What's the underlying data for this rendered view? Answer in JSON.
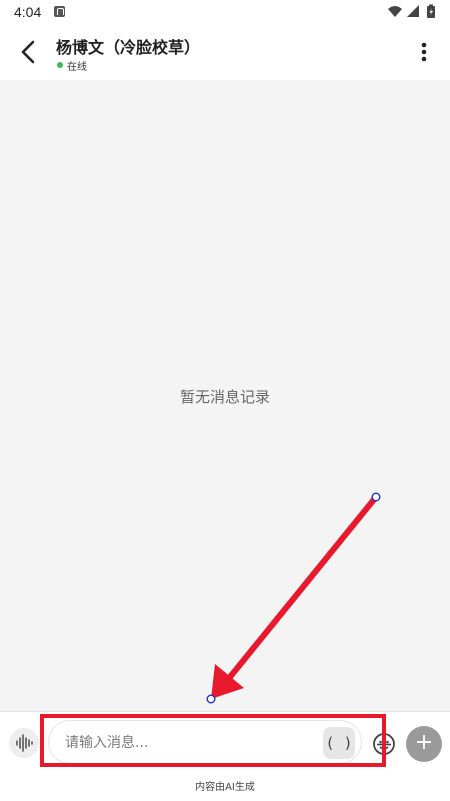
{
  "status_bar": {
    "time": "4:04"
  },
  "header": {
    "contact_name": "杨博文（冷脸校草）",
    "online_status": "在线"
  },
  "chat": {
    "empty_text": "暂无消息记录"
  },
  "composer": {
    "placeholder": "请输入消息...",
    "paren_label": "( )",
    "add_label": "+"
  },
  "footer": {
    "notice": "内容由AI生成"
  },
  "colors": {
    "online_dot": "#3cba54",
    "annotation_red": "#e8192c",
    "chat_background": "#f4f4f4"
  },
  "icons": [
    "back-arrow-icon",
    "more-vertical-icon",
    "voice-wave-icon",
    "emoji-icon",
    "plus-icon",
    "wifi-icon",
    "signal-icon",
    "battery-icon"
  ]
}
